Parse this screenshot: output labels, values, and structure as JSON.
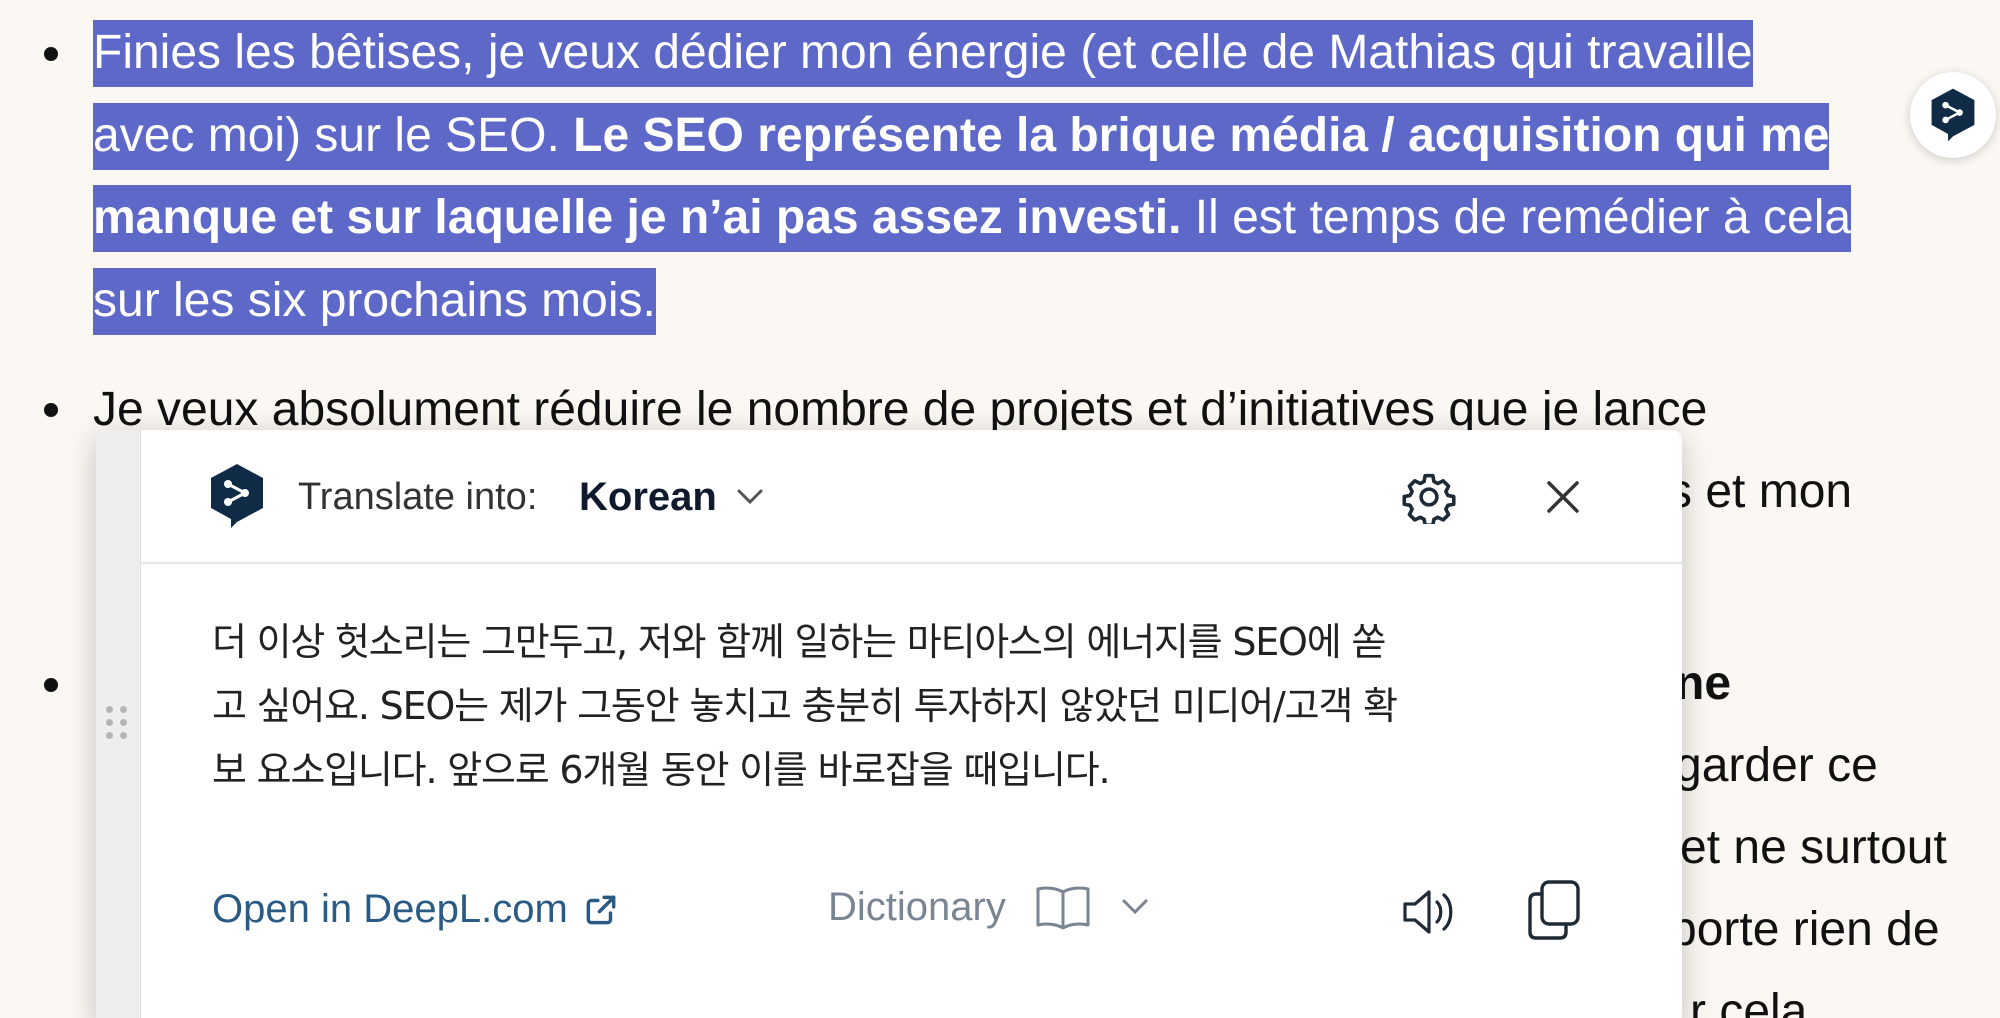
{
  "article": {
    "item1": {
      "line1": "Finies les bêtises, je veux dédier mon énergie (et celle de Mathias qui travaille",
      "line2_normal": "avec moi) sur le SEO. ",
      "line2_bold": "Le SEO représente la brique média / acquisition qui me",
      "line3_bold": "manque et sur laquelle je n’ai pas assez investi.",
      "line3_normal": " Il est temps de remédier à cela",
      "line4": "sur les six prochains mois."
    },
    "item2": {
      "line1": "Je veux absolument réduire le nombre de projets et d’initiatives que je lance",
      "fragment_right": "s et mon"
    },
    "item3": {
      "fragment_bold": "ne",
      "fragment_2": "garder ce",
      "fragment_3": "et ne surtout",
      "fragment_4": "porte rien de",
      "fragment_5": "r cela"
    }
  },
  "popup": {
    "translate_label": "Translate into:",
    "language": "Korean",
    "translation_lines": [
      "더 이상 헛소리는 그만두고, 저와 함께 일하는 마티아스의 에너지를 SEO에 쏟",
      "고 싶어요. SEO는 제가 그동안 놓치고 충분히 투자하지 않았던 미디어/고객 확",
      "보 요소입니다. 앞으로 6개월 동안 이를 바로잡을 때입니다."
    ],
    "open_link": "Open in DeepL.com",
    "dictionary": "Dictionary"
  },
  "colors": {
    "selection": "#5d68c9",
    "deepl_navy": "#0f2b46",
    "link": "#2a5b84",
    "background": "#fbf7f2"
  },
  "icons": [
    "deepl-logo-icon",
    "chevron-down-icon",
    "gear-icon",
    "close-icon",
    "external-link-icon",
    "book-icon",
    "speaker-icon",
    "copy-icon",
    "drag-handle-icon"
  ]
}
